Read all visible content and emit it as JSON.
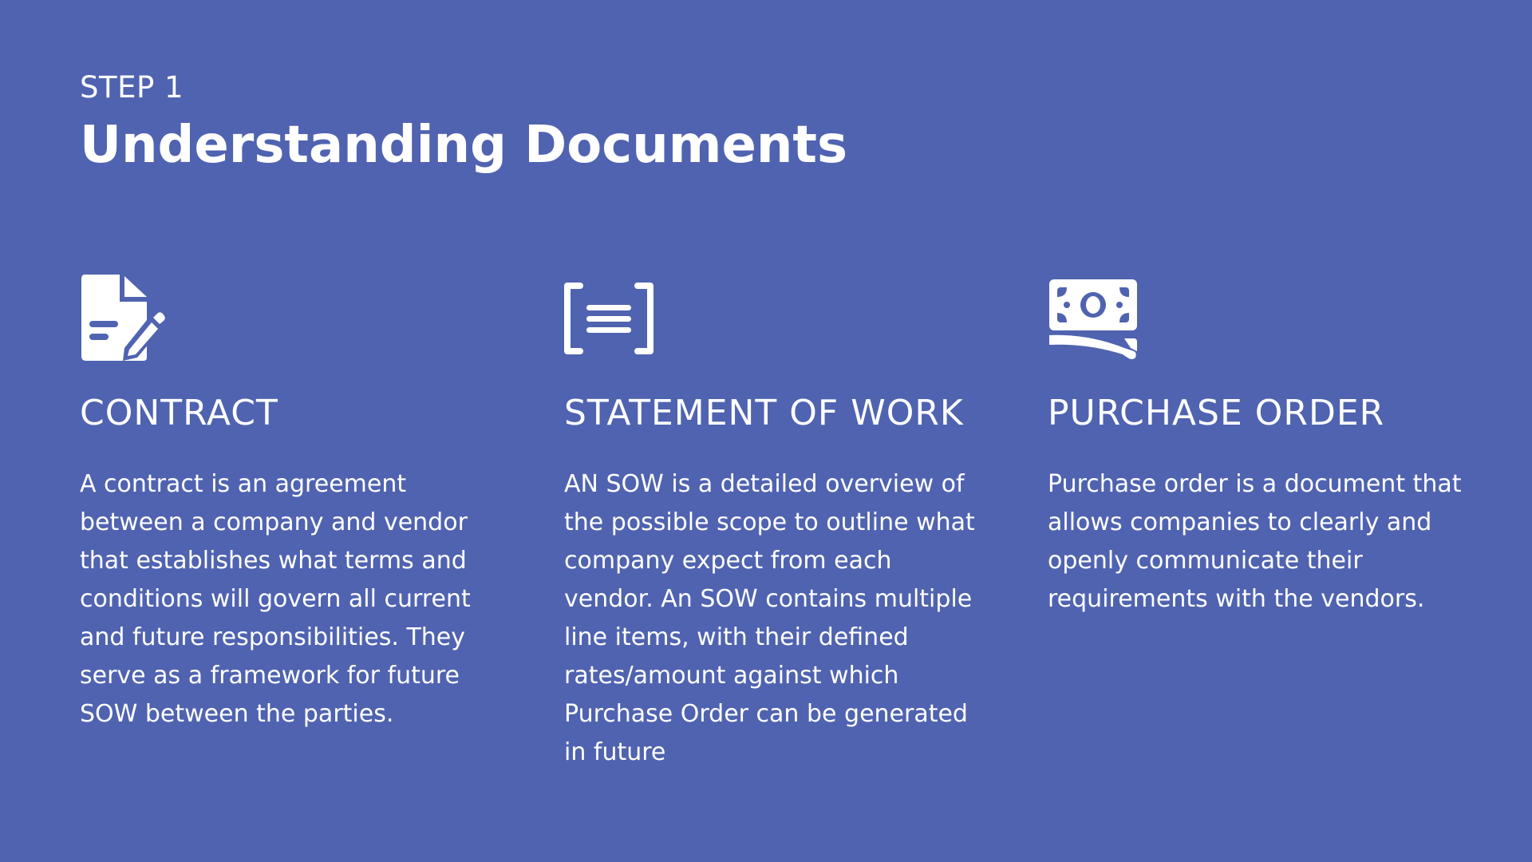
{
  "header": {
    "step": "STEP 1",
    "title": "Understanding Documents"
  },
  "colors": {
    "background": "#5063b0",
    "text": "#ffffff"
  },
  "columns": [
    {
      "icon": "document-signature-icon",
      "heading": "CONTRACT",
      "body": "A contract is an agreement between a company and vendor that establishes what terms and conditions will govern all current and future responsibilities. They serve as a framework for future SOW between the parties."
    },
    {
      "icon": "bracketed-text-icon",
      "heading": "STATEMENT OF WORK",
      "body": "AN SOW is a detailed overview of the possible scope to outline what company expect from each vendor. An SOW contains multiple line items, with their defined rates/amount against which Purchase Order can be generated in future"
    },
    {
      "icon": "money-bill-icon",
      "heading": "PURCHASE ORDER",
      "body": "Purchase order is a document that allows companies to clearly and openly communicate their requirements with the vendors."
    }
  ]
}
